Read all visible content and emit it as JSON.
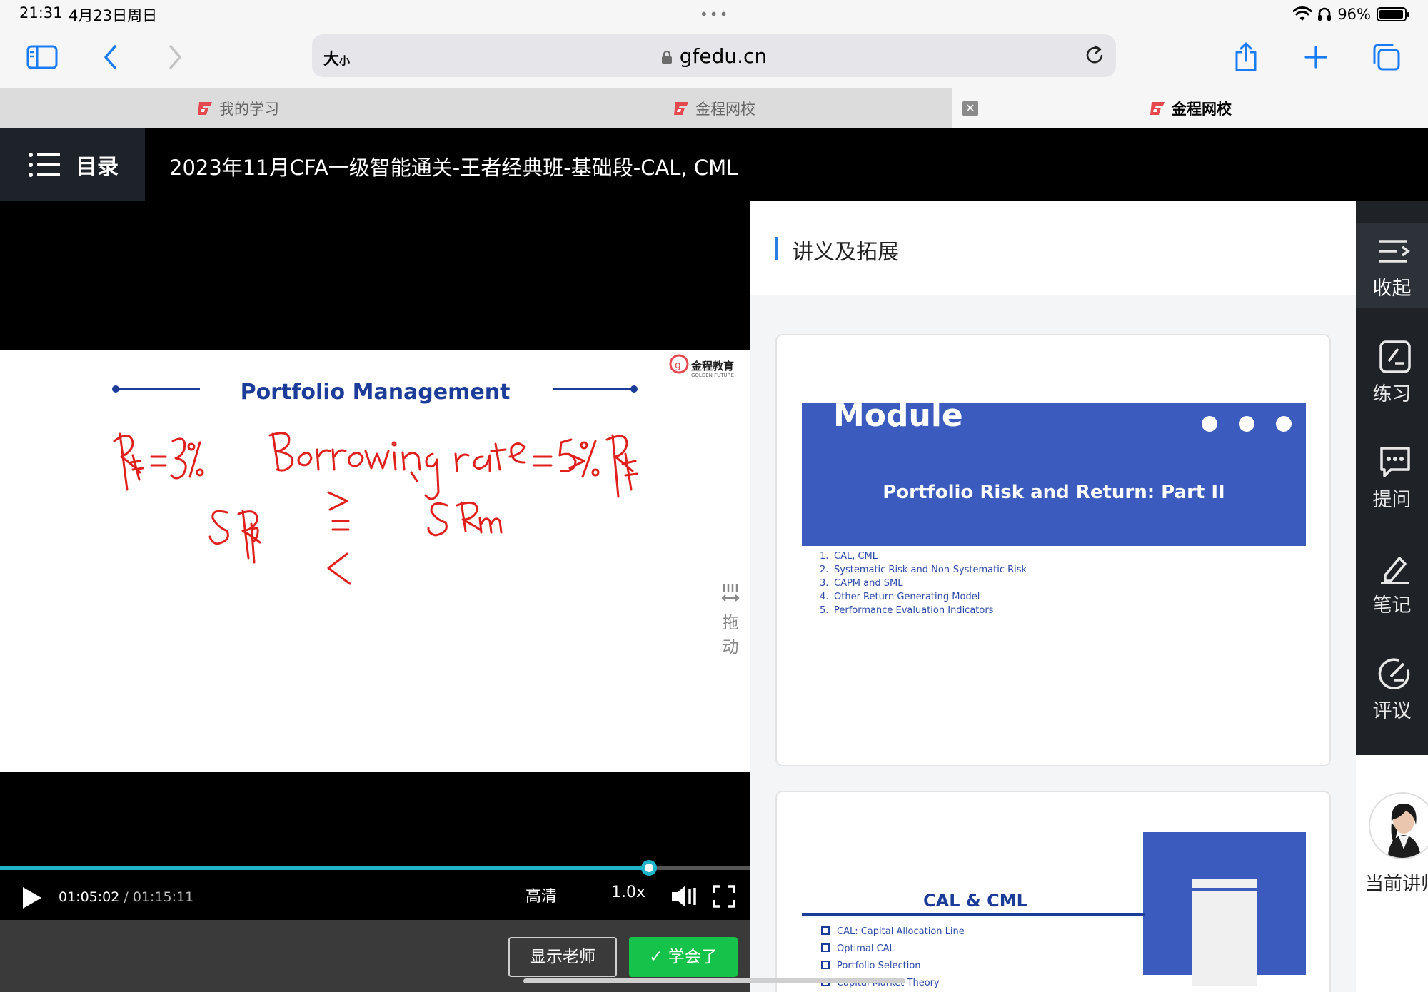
{
  "status_bar": {
    "time": "21:31",
    "date": "4月23日周日",
    "battery": "96%",
    "battery_level": 0.96
  },
  "browser": {
    "text_size_label": "大",
    "text_size_small": "小",
    "url": "gfedu.cn",
    "tabs": [
      {
        "label": "我的学习",
        "active": false
      },
      {
        "label": "金程网校",
        "active": false
      },
      {
        "label": "金程网校",
        "active": true
      }
    ],
    "icons": [
      "sidebar-icon",
      "back-icon",
      "forward-icon",
      "reload-icon",
      "share-icon",
      "new-tab-icon",
      "tabs-overview-icon"
    ]
  },
  "header": {
    "catalog_label": "目录",
    "title": "2023年11月CFA一级智能通关-王者经典班-基础段-CAL, CML"
  },
  "video": {
    "slide_title": "Portfolio Management",
    "slide_logo": "金程教育",
    "slide_logo_sub": "GOLDEN FUTURE",
    "handwriting": {
      "line1_left": "Rf = 3%",
      "line1_right": "Borrowing rate = 5% > Rf",
      "line2_left": "SRp",
      "line2_right": "SRm",
      "comparators": [
        ">",
        "=",
        "<"
      ]
    },
    "drag_label_1": "拖",
    "drag_label_2": "动",
    "current_time": "01:05:02",
    "separator": " / ",
    "total_time": "01:15:11",
    "progress": 0.865,
    "quality": "高清",
    "speed": "1.0x",
    "show_teacher_label": "显示老师",
    "learned_label": "✓ 学会了",
    "colors": {
      "progress": "#1fb3c9",
      "learned_button": "#15c24a",
      "slide_title": "#1b3c98",
      "ink": "#e0201c"
    }
  },
  "handout": {
    "title": "讲义及拓展",
    "card1": {
      "module_word": "Module",
      "subtitle": "Portfolio Risk and Return: Part II",
      "items": [
        {
          "n": "1.",
          "text": "CAL, CML"
        },
        {
          "n": "2.",
          "text": "Systematic Risk and Non-Systematic Risk"
        },
        {
          "n": "3.",
          "text": "CAPM and SML"
        },
        {
          "n": "4.",
          "text": "Other Return Generating Model"
        },
        {
          "n": "5.",
          "text": "Performance Evaluation Indicators"
        }
      ]
    },
    "card2": {
      "title": "CAL & CML",
      "items": [
        "CAL: Capital Allocation Line",
        "Optimal CAL",
        "Portfolio Selection",
        "Capital Market Theory"
      ]
    }
  },
  "sidebar": {
    "items": [
      {
        "label": "收起",
        "icon": "collapse-icon"
      },
      {
        "label": "练习",
        "icon": "practice-icon"
      },
      {
        "label": "提问",
        "icon": "question-icon"
      },
      {
        "label": "笔记",
        "icon": "notes-icon"
      },
      {
        "label": "评议",
        "icon": "review-icon"
      }
    ],
    "lecturer_label": "当前讲师"
  }
}
